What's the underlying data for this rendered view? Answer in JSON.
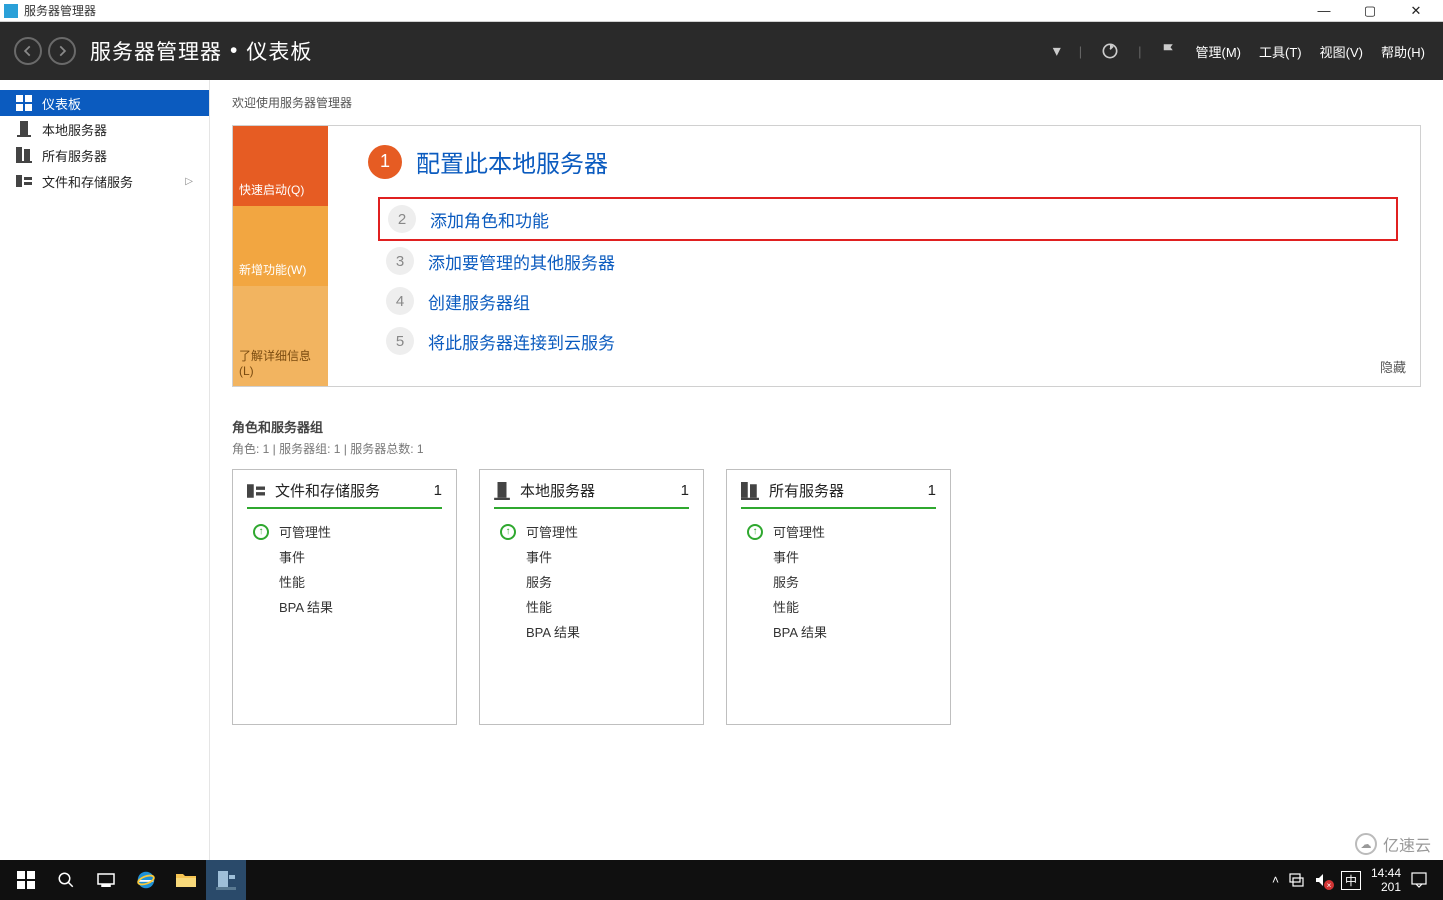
{
  "window": {
    "title": "服务器管理器"
  },
  "header": {
    "app": "服务器管理器",
    "page": "仪表板",
    "menus": {
      "manage": "管理(M)",
      "tools": "工具(T)",
      "view": "视图(V)",
      "help": "帮助(H)"
    }
  },
  "sidebar": {
    "items": [
      {
        "label": "仪表板"
      },
      {
        "label": "本地服务器"
      },
      {
        "label": "所有服务器"
      },
      {
        "label": "文件和存储服务"
      }
    ]
  },
  "welcome": {
    "heading": "欢迎使用服务器管理器",
    "tabs": {
      "quick": "快速启动(Q)",
      "new": "新增功能(W)",
      "learn": "了解详细信息(L)"
    },
    "title": "配置此本地服务器",
    "steps": [
      {
        "n": "2",
        "label": "添加角色和功能"
      },
      {
        "n": "3",
        "label": "添加要管理的其他服务器"
      },
      {
        "n": "4",
        "label": "创建服务器组"
      },
      {
        "n": "5",
        "label": "将此服务器连接到云服务"
      }
    ],
    "hide": "隐藏"
  },
  "groups": {
    "heading": "角色和服务器组",
    "sub": "角色: 1 | 服务器组: 1 | 服务器总数: 1",
    "cards": [
      {
        "title": "文件和存储服务",
        "count": "1",
        "rows": [
          "可管理性",
          "事件",
          "性能",
          "BPA 结果"
        ]
      },
      {
        "title": "本地服务器",
        "count": "1",
        "rows": [
          "可管理性",
          "事件",
          "服务",
          "性能",
          "BPA 结果"
        ]
      },
      {
        "title": "所有服务器",
        "count": "1",
        "rows": [
          "可管理性",
          "事件",
          "服务",
          "性能",
          "BPA 结果"
        ]
      }
    ]
  },
  "tray": {
    "ime": "中",
    "time": "14:44",
    "date": "201"
  },
  "watermark": "亿速云"
}
